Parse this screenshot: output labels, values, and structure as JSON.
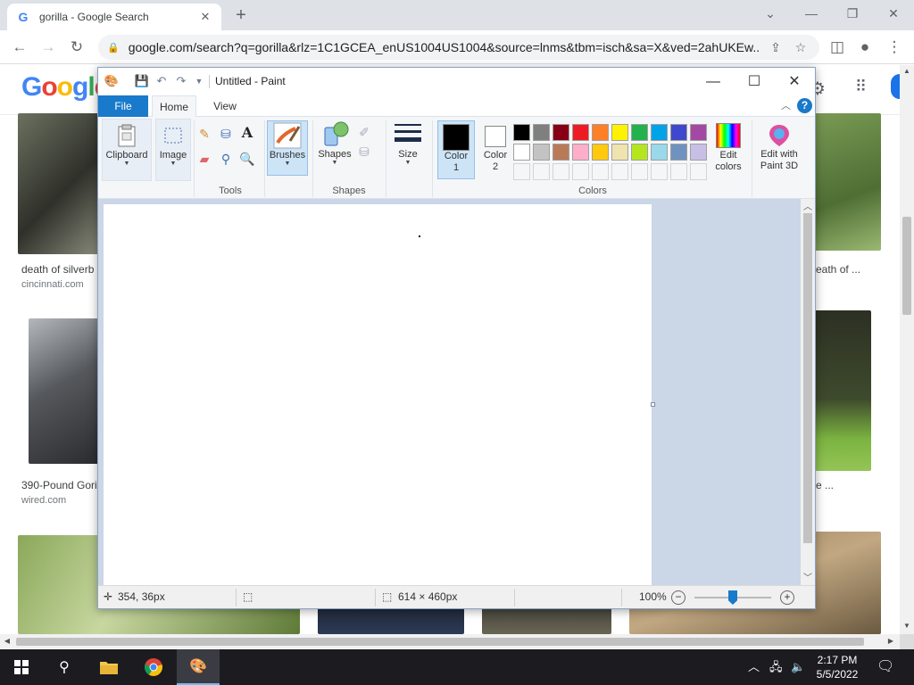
{
  "browser": {
    "tab_title": "gorilla - Google Search",
    "url": "google.com/search?q=gorilla&rlz=1C1GCEA_enUS1004US1004&source=lnms&tbm=isch&sa=X&ved=2ahUKEw..."
  },
  "google": {
    "logo_letters": [
      "G",
      "o",
      "o",
      "g",
      "l",
      "e"
    ],
    "results": [
      {
        "title": "death of silverb",
        "site": "cincinnati.com"
      },
      {
        "title": "eath of ...",
        "site": ""
      },
      {
        "title": "390-Pound Gori",
        "site": "wired.com"
      },
      {
        "title": "e ...",
        "site": ""
      }
    ]
  },
  "paint": {
    "window_title": "Untitled - Paint",
    "tabs": {
      "file": "File",
      "home": "Home",
      "view": "View"
    },
    "ribbon": {
      "clipboard": "Clipboard",
      "image": "Image",
      "tools_group": "Tools",
      "brushes": "Brushes",
      "shapes": "Shapes",
      "shapes_group": "Shapes",
      "size": "Size",
      "color1_line1": "Color",
      "color1_line2": "1",
      "color2_line1": "Color",
      "color2_line2": "2",
      "colors_group": "Colors",
      "edit_colors_line1": "Edit",
      "edit_colors_line2": "colors",
      "paint3d_line1": "Edit with",
      "paint3d_line2": "Paint 3D"
    },
    "palette": {
      "row1": [
        "#000000",
        "#7f7f7f",
        "#880015",
        "#ed1c24",
        "#ff7f27",
        "#fff200",
        "#22b14c",
        "#00a2e8",
        "#3f48cc",
        "#a349a4"
      ],
      "row2": [
        "#ffffff",
        "#c3c3c3",
        "#b97a57",
        "#ffaec9",
        "#ffc90e",
        "#efe4b0",
        "#b5e61d",
        "#99d9ea",
        "#7092be",
        "#c8bfe7"
      ]
    },
    "color1": "#000000",
    "color2": "#ffffff",
    "status": {
      "cursor_pos": "354, 36px",
      "canvas_size": "614 × 460px",
      "zoom": "100%"
    }
  },
  "taskbar": {
    "time": "2:17 PM",
    "date": "5/5/2022"
  }
}
